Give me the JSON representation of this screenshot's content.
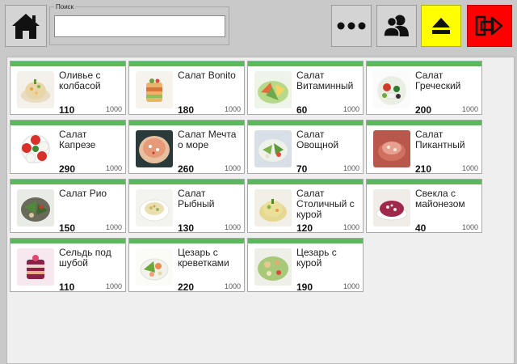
{
  "search": {
    "label": "Поиск",
    "value": "",
    "placeholder": ""
  },
  "toolbar": {
    "home_icon": "home-icon",
    "more_icon": "ellipsis-icon",
    "users_icon": "users-icon",
    "eject_icon": "eject-icon",
    "logout_icon": "exit-icon",
    "eject_color": "#ffff00",
    "logout_color": "#ff0000"
  },
  "accent_color": "#5cb85c",
  "products": [
    {
      "name": "Оливье с колбасой",
      "price": "110",
      "qty": "1000"
    },
    {
      "name": "Салат Bonito",
      "price": "180",
      "qty": "1000"
    },
    {
      "name": "Салат Витаминный",
      "price": "60",
      "qty": "1000"
    },
    {
      "name": "Салат Греческий",
      "price": "200",
      "qty": "1000"
    },
    {
      "name": "Салат Капрезе",
      "price": "290",
      "qty": "1000"
    },
    {
      "name": "Салат Мечта о море",
      "price": "260",
      "qty": "1000"
    },
    {
      "name": "Салат Овощной",
      "price": "70",
      "qty": "1000"
    },
    {
      "name": "Салат Пикантный",
      "price": "210",
      "qty": "1000"
    },
    {
      "name": "Салат Рио",
      "price": "150",
      "qty": "1000"
    },
    {
      "name": "Салат Рыбный",
      "price": "130",
      "qty": "1000"
    },
    {
      "name": "Салат Столичный с курой",
      "price": "120",
      "qty": "1000"
    },
    {
      "name": "Свекла с майонезом",
      "price": "40",
      "qty": "1000"
    },
    {
      "name": "Сельдь под шубой",
      "price": "110",
      "qty": "1000"
    },
    {
      "name": "Цезарь с креветками",
      "price": "220",
      "qty": "1000"
    },
    {
      "name": "Цезарь с курой",
      "price": "190",
      "qty": "1000"
    }
  ]
}
